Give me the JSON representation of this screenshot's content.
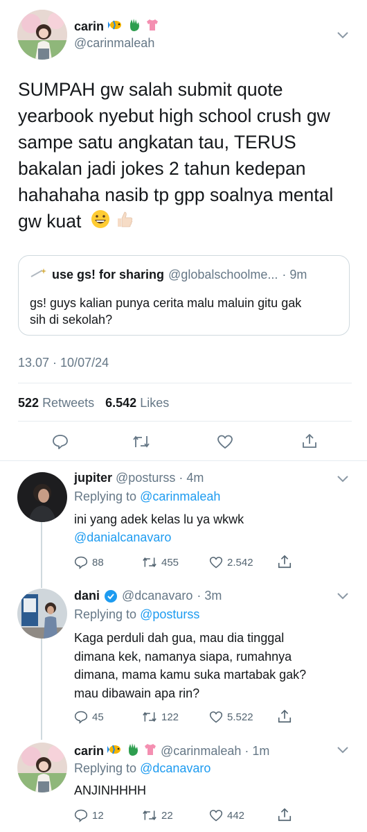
{
  "main_tweet": {
    "name": "carin",
    "handle": "@carinmaleah",
    "text": "SUMPAH gw salah submit quote yearbook nyebut high school crush gw sampe satu angkatan tau, TERUS bakalan jadi jokes 2 tahun kedepan hahahaha nasib tp gpp soalnya mental gw kuat",
    "quote": {
      "name": "use gs! for sharing",
      "handle": "@globalschoolme...",
      "time": "· 9m",
      "text": "gs! guys kalian punya cerita malu maluin gitu gak sih di sekolah?"
    },
    "timestamp": "13.07 · 10/07/24",
    "retweets_count": "522",
    "retweets_label": "Retweets",
    "likes_count": "6.542",
    "likes_label": "Likes"
  },
  "replies": [
    {
      "name": "jupiter",
      "handle": "@posturss",
      "time": "· 4m",
      "replying_prefix": "Replying to",
      "replying_to": "@carinmaleah",
      "text": "ini yang adek kelas lu ya wkwk",
      "mention": "@danialcanavaro",
      "comments": "88",
      "retweets": "455",
      "likes": "2.542"
    },
    {
      "name": "dani",
      "handle": "@dcanavaro",
      "time": "· 3m",
      "replying_prefix": "Replying to",
      "replying_to": "@posturss",
      "text": "Kaga perduli dah gua, mau dia tinggal dimana kek, namanya siapa, rumahnya dimana, mama kamu suka martabak gak? mau dibawain apa rin?",
      "comments": "45",
      "retweets": "122",
      "likes": "5.522"
    },
    {
      "name": "carin",
      "handle": "@carinmaleah",
      "time": "· 1m",
      "replying_prefix": "Replying to",
      "replying_to": "@dcanavaro",
      "text": "ANJINHHHH",
      "comments": "12",
      "retweets": "22",
      "likes": "442"
    }
  ],
  "colors": {
    "link": "#1d9bf0",
    "muted": "#657786",
    "divider": "#e6ecf0",
    "verified": "#1d9bf0"
  },
  "icons": [
    "chevron-down-icon",
    "reply-icon",
    "retweet-icon",
    "like-icon",
    "share-icon",
    "verified-badge-icon",
    "fish-emoji",
    "glove-emoji",
    "shirt-emoji",
    "grin-emoji",
    "thumbs-up-emoji",
    "sparkle-icon"
  ]
}
